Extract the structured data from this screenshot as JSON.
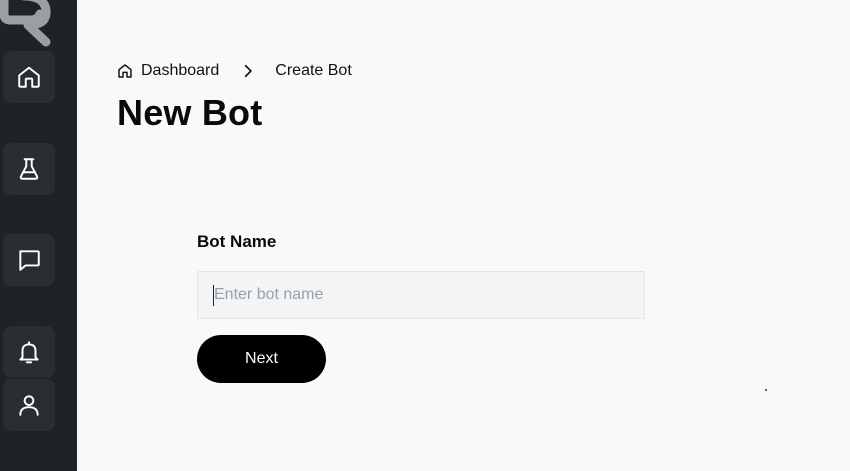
{
  "sidebar": {
    "logo_icon": "r-logo-icon",
    "items": [
      {
        "icon": "home-icon",
        "name": "Home"
      },
      {
        "icon": "flask-icon",
        "name": "Labs"
      },
      {
        "icon": "chat-icon",
        "name": "Chat"
      },
      {
        "icon": "bell-icon",
        "name": "Notifications"
      },
      {
        "icon": "user-icon",
        "name": "Profile"
      }
    ]
  },
  "breadcrumb": {
    "home_label": "Dashboard",
    "current_label": "Create Bot"
  },
  "page": {
    "title": "New Bot"
  },
  "form": {
    "bot_name_label": "Bot Name",
    "bot_name_value": "",
    "bot_name_placeholder": "Enter bot name",
    "next_label": "Next"
  },
  "colors": {
    "sidebar_bg": "#1f2326",
    "nav_button_bg": "#2a2e31",
    "page_bg": "#f8f9fb",
    "primary_button": "#000000"
  }
}
